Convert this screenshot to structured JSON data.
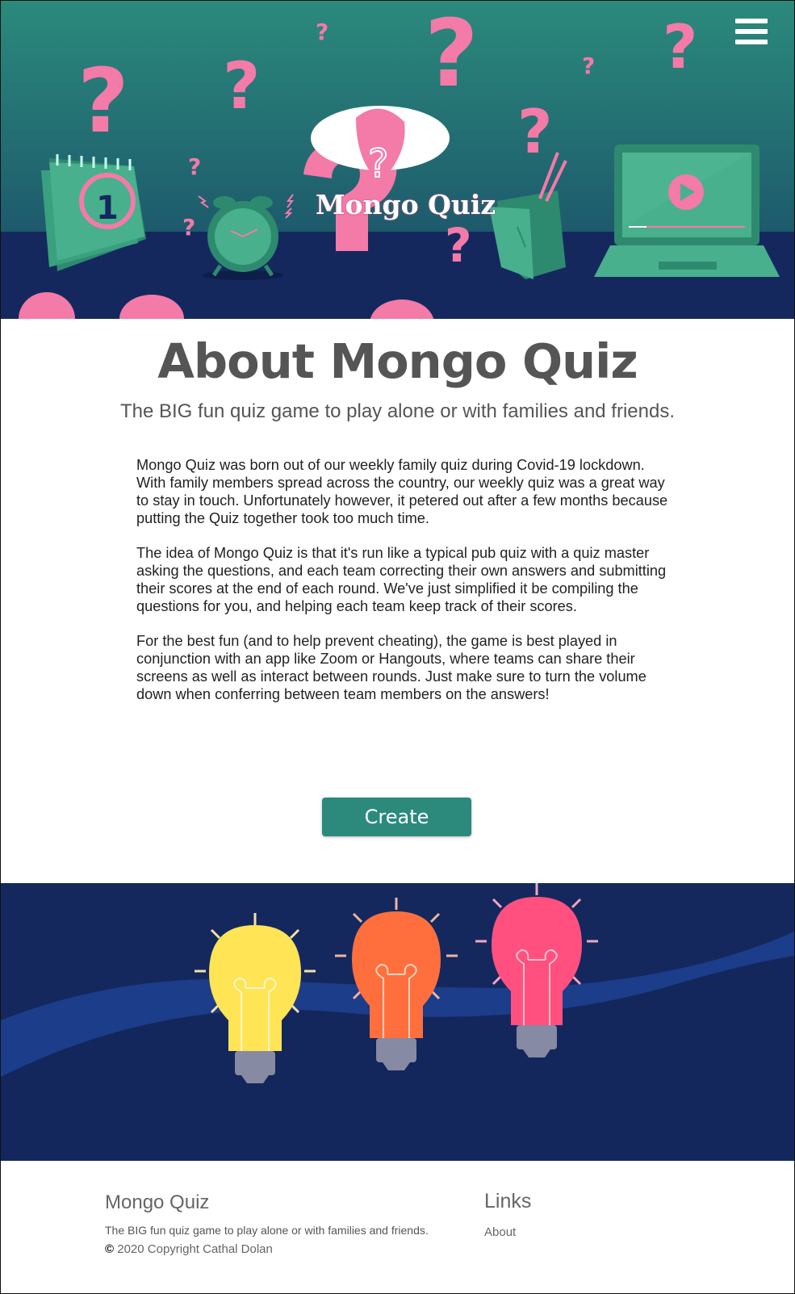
{
  "header": {
    "logo_text": "Mongo Quiz",
    "menu_icon": "hamburger-menu-icon",
    "calendar_day": "1",
    "colors": {
      "teal": "#2b8a7c",
      "navy": "#14285e",
      "pink": "#f47aa8"
    }
  },
  "main": {
    "title": "About Mongo Quiz",
    "subtitle": "The BIG fun quiz game to play alone or with families and friends.",
    "paragraphs": [
      "Mongo Quiz was born out of our weekly family quiz during Covid-19 lockdown. With family members spread across the country, our weekly quiz was a great way to stay in touch. Unfortunately however, it petered out after a few months because putting the Quiz together took too much time.",
      "The idea of Mongo Quiz is that it's run like a typical pub quiz with a quiz master asking the questions, and each team correcting their own answers and submitting their scores at the end of each round. We've just simplified it be compiling the questions for you, and helping each team keep track of their scores.",
      "For the best fun (and to help prevent cheating), the game is best played in conjunction with an app like Zoom or Hangouts, where teams can share their screens as well as interact between rounds. Just make sure to turn the volume down when conferring between team members on the answers!"
    ],
    "create_label": "Create"
  },
  "footer": {
    "title": "Mongo Quiz",
    "tagline": "The BIG fun quiz game to play alone or with families and friends.",
    "copyright_symbol": "©",
    "copyright": "2020 Copyright Cathal Dolan",
    "links_heading": "Links",
    "about_link": "About"
  }
}
